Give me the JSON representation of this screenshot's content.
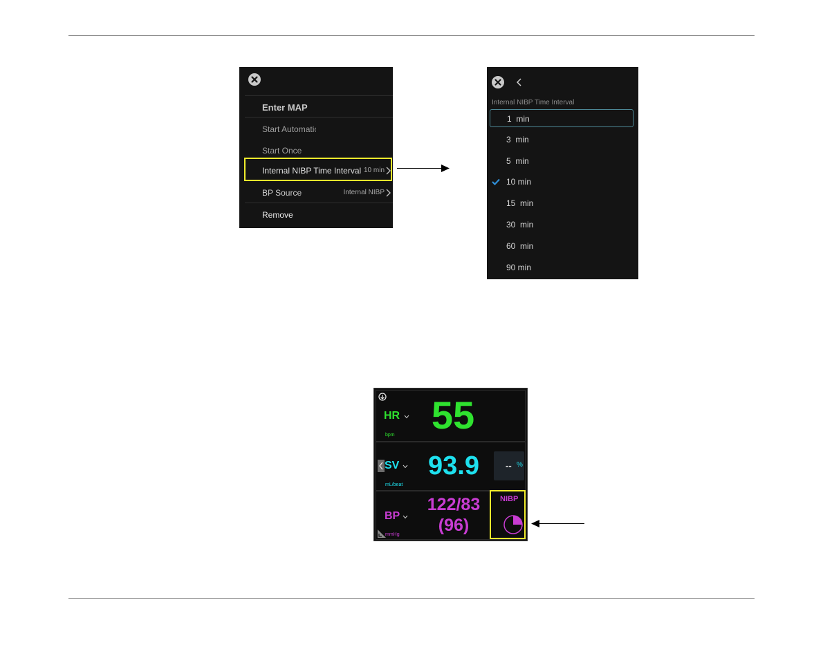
{
  "menu": {
    "title": "Enter MAP",
    "items": [
      {
        "label": "Start Automatic"
      },
      {
        "label": "Start Once"
      },
      {
        "label": "Internal NIBP Time Interval",
        "value": "10 min"
      },
      {
        "label": "BP Source",
        "value": "Internal NIBP"
      },
      {
        "label": "Remove"
      }
    ]
  },
  "interval_panel": {
    "title": "Internal NIBP Time Interval",
    "options": [
      "1  min",
      "3  min",
      "5  min",
      "10 min",
      "15  min",
      "30  min",
      "60  min",
      "90 min"
    ],
    "selected": "10 min",
    "focused": "1  min"
  },
  "monitor": {
    "hr": {
      "label": "HR",
      "value": "55",
      "unit": "bpm",
      "color": "#2fe22f"
    },
    "sv": {
      "label": "SV",
      "value": "93.9",
      "unit": "mL/beat",
      "color": "#1ee0ee",
      "change_value": "--",
      "change_unit": "%"
    },
    "bp": {
      "label": "BP",
      "systolic_diastolic": "122/83",
      "map": "(96)",
      "unit": "mmHg",
      "color": "#c83cd2",
      "source_label": "NIBP",
      "interval_progress": 0.25
    }
  },
  "colors": {
    "highlight": "#f0ec2c",
    "check": "#2f8fd8"
  }
}
